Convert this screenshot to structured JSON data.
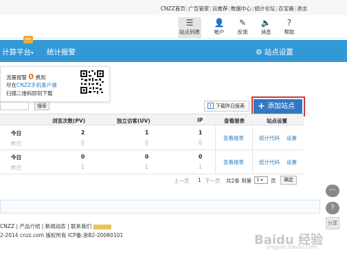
{
  "top_links": [
    "CNZZ首页",
    "广告管家",
    "云推荐",
    "数据中心",
    "统计论坛",
    "百宝箱",
    "退出"
  ],
  "toolbar": {
    "items": [
      {
        "label": "站点列表",
        "icon": "list-icon"
      },
      {
        "label": "帐户",
        "icon": "user-icon"
      },
      {
        "label": "反馈",
        "icon": "edit-icon"
      },
      {
        "label": "消息",
        "icon": "speaker-icon"
      },
      {
        "label": "帮助",
        "icon": "help-icon"
      }
    ]
  },
  "nav": {
    "platform_label": "计算平台",
    "stats_label": "统计报警",
    "settings_label": "站点设置"
  },
  "notice": {
    "line1_prefix": "流量报警",
    "line1_zero": "0",
    "line1_suffix": "费用",
    "line2_prefix": "尽在",
    "line2_link": "CNZZ手机客户端",
    "line3": "扫描二维码即刻下载"
  },
  "search": {
    "button_label": "搜索"
  },
  "actions": {
    "download_label": "下载昨日报表",
    "add_site_label": "添加站点"
  },
  "table": {
    "headers": [
      "浏览次数(PV)",
      "独立访客(UV)",
      "IP",
      "查看报表",
      "站点设置"
    ],
    "rows": [
      {
        "today_label": "今日",
        "today_pv": "2",
        "today_uv": "1",
        "today_ip": "1",
        "yest_label": "昨日",
        "yest_pv": "0",
        "yest_uv": "0",
        "yest_ip": "0",
        "view_report": "查看报表",
        "stats_code": "统计代码",
        "settings": "设置"
      },
      {
        "today_label": "今日",
        "today_pv": "0",
        "today_uv": "0",
        "today_ip": "0",
        "yest_label": "昨日",
        "yest_pv": "1",
        "yest_uv": "1",
        "yest_ip": "1",
        "view_report": "查看报表",
        "stats_code": "统计代码",
        "settings": "设置"
      }
    ]
  },
  "pager": {
    "prev": "上一页",
    "page_num": "1",
    "next": "下一页",
    "total": "共2条 到第",
    "select_value": "1",
    "page_unit": "页",
    "confirm": "确定"
  },
  "footer": {
    "links": "CNZZ | 产品介绍 | 新闻动态 | 联系我们",
    "copyright": "2-2014 cnzz.com 版权所有 ICP备:浙B2-20080101"
  },
  "side": {
    "chat_icon": "chat-icon",
    "help_icon": "question-icon",
    "share_label": "分享"
  },
  "watermark": {
    "text": "Baidu 经验",
    "sub": "jingyan.baidu.com"
  }
}
